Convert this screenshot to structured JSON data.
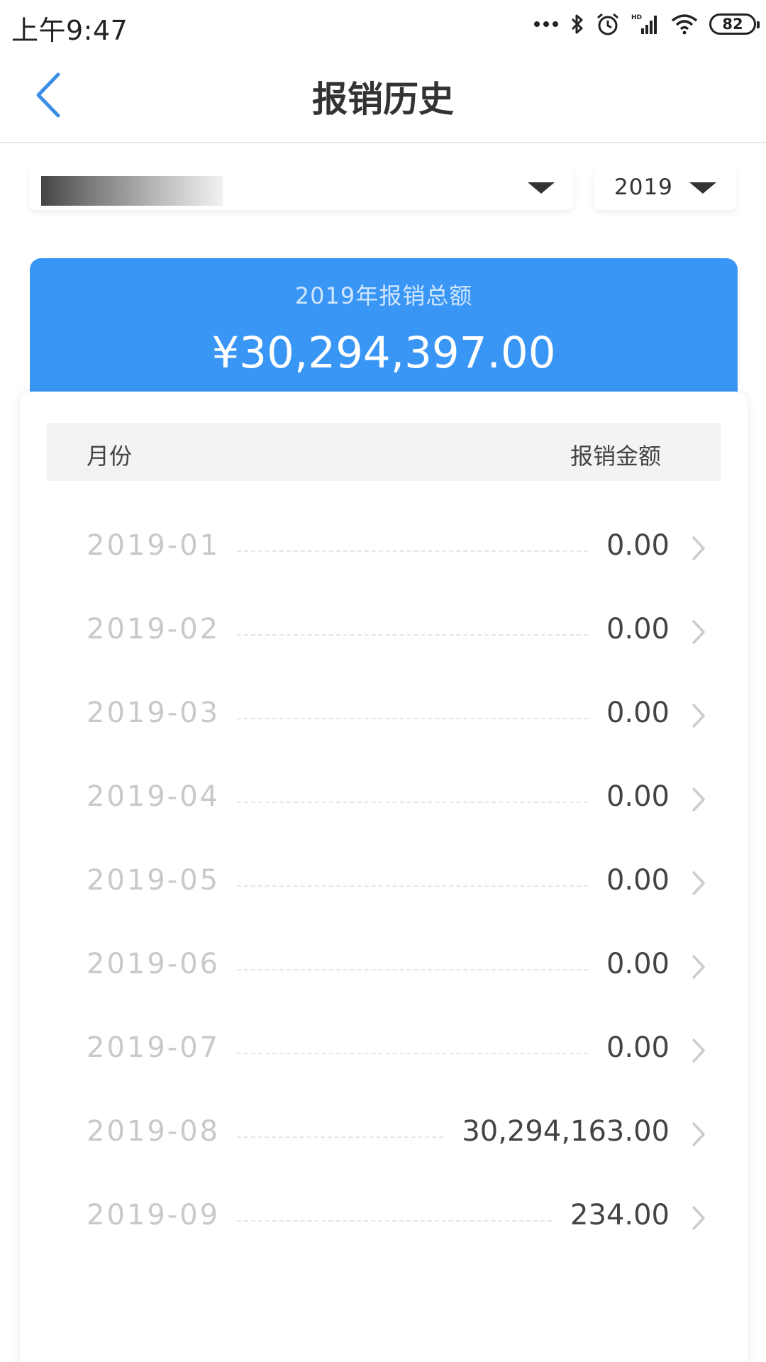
{
  "status_bar": {
    "time": "上午9:47",
    "battery": "82",
    "icons": [
      "more-dots-icon",
      "bluetooth-icon",
      "alarm-icon",
      "signal-icon",
      "wifi-icon",
      "battery-icon"
    ]
  },
  "header": {
    "title": "报销历史",
    "back_icon": "chevron-left-icon"
  },
  "filters": {
    "account": "",
    "year": "2019"
  },
  "summary": {
    "label": "2019年报销总额",
    "amount": "¥30,294,397.00"
  },
  "table": {
    "columns": [
      "月份",
      "报销金额"
    ],
    "rows": [
      {
        "month": "2019-01",
        "amount": "0.00"
      },
      {
        "month": "2019-02",
        "amount": "0.00"
      },
      {
        "month": "2019-03",
        "amount": "0.00"
      },
      {
        "month": "2019-04",
        "amount": "0.00"
      },
      {
        "month": "2019-05",
        "amount": "0.00"
      },
      {
        "month": "2019-06",
        "amount": "0.00"
      },
      {
        "month": "2019-07",
        "amount": "0.00"
      },
      {
        "month": "2019-08",
        "amount": "30,294,163.00"
      },
      {
        "month": "2019-09",
        "amount": "234.00"
      }
    ]
  },
  "colors": {
    "accent": "#3996f5",
    "back_icon": "#3a8ee6",
    "month_text": "#c9c9c9",
    "amount_text": "#444444",
    "header_bg": "#f3f3f3"
  }
}
